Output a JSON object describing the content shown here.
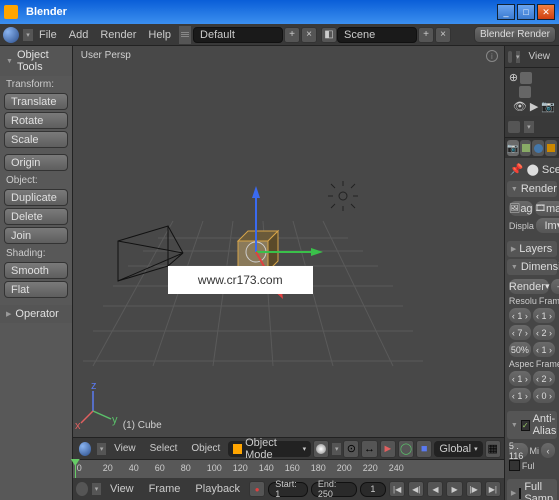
{
  "window": {
    "title": "Blender"
  },
  "topMenu": {
    "file": "File",
    "add": "Add",
    "render": "Render",
    "help": "Help",
    "layoutName": "Default",
    "sceneLabel": "Scene",
    "engine": "Blender Render"
  },
  "toolshelf": {
    "header": "Object Tools",
    "sections": {
      "transform": "Transform:",
      "object": "Object:",
      "shading": "Shading:"
    },
    "buttons": {
      "translate": "Translate",
      "rotate": "Rotate",
      "scale": "Scale",
      "origin": "Origin",
      "duplicate": "Duplicate",
      "delete": "Delete",
      "join": "Join",
      "smooth": "Smooth",
      "flat": "Flat"
    },
    "operator": "Operator"
  },
  "viewport": {
    "perspLabel": "User Persp",
    "objectLabel": "(1) Cube",
    "watermark": "www.cr173.com"
  },
  "viewportHeader": {
    "view": "View",
    "select": "Select",
    "object": "Object",
    "mode": "Object Mode",
    "orientation": "Global"
  },
  "timeline": {
    "ticks": [
      "0",
      "20",
      "40",
      "60",
      "80",
      "100",
      "120",
      "140",
      "160",
      "180",
      "200",
      "220",
      "240"
    ],
    "menu": {
      "view": "View",
      "frame": "Frame",
      "playback": "Playback"
    },
    "startLabel": "Start: 1",
    "endLabel": "End: 250",
    "currentFrame": "1"
  },
  "outliner": {
    "viewMenu": "View"
  },
  "properties": {
    "scene": "Scene",
    "panels": {
      "render": "Render",
      "layers": "Layers",
      "dimensions": "Dimensions",
      "antialias": "Anti-Alias",
      "fullsample": "Full Samp"
    },
    "renderBtnShort": "ag",
    "animBtnShort": "mat",
    "displayLabel": "Displa",
    "displayValue": "Im",
    "presetLabel": "Render",
    "resoLabel": "Resolu",
    "frameLabel": "Frame",
    "resoX": "‹ 1 ›",
    "resoY": "‹ 7 ›",
    "resoPct": "50%",
    "frStart": "‹ 1 ›",
    "frEnd": "‹ 2 ›",
    "frStep": "‹ 1 ›",
    "aspecLabel": "Aspec",
    "frameRateLabel": "Frame",
    "aspX": "‹ 1 ›",
    "aspY": "‹ 1 ›",
    "fr2a": "‹ 2 ›",
    "fr2b": "‹ 0 ›",
    "aaSample": "5 . 116",
    "aaMi": "Mi",
    "aaFull": "Ful"
  },
  "chart_data": null
}
